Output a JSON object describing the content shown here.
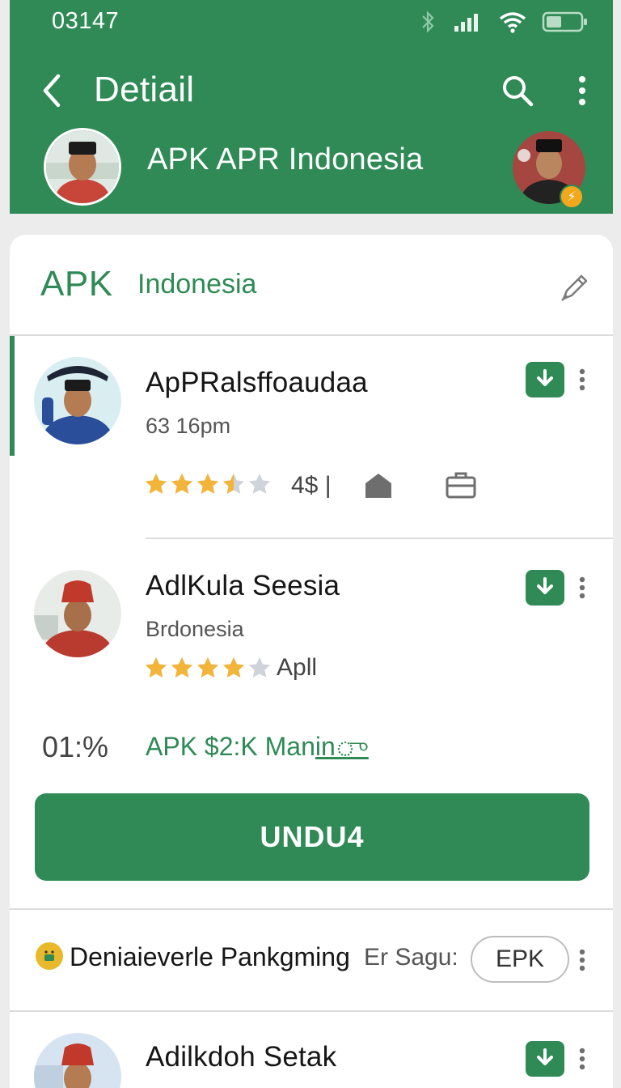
{
  "status_bar": {
    "time": "03147",
    "icons": [
      "bluetooth-icon",
      "signal-icon",
      "wifi-icon",
      "battery-icon"
    ]
  },
  "header": {
    "title": "Detiail",
    "profile_name": "APK APR Indonesia",
    "badge_symbol": "⚡"
  },
  "section": {
    "label": "APK",
    "country": "Indonesia"
  },
  "items": [
    {
      "title": "ApPRalsffoaudaa",
      "subtitle": "63 16pm",
      "rating": 3.5,
      "rating_text": "4$ |",
      "active": true
    },
    {
      "title": "AdlKula Seesia",
      "subtitle": "Brdonesia",
      "rating": 4,
      "rating_text": "Apll"
    },
    {
      "title": "Adilkdoh Setak"
    }
  ],
  "stats": {
    "percent": "01:%",
    "link_text": "APK $2:K Man",
    "link_suffix": "inு"
  },
  "primary_button": "UNDU4",
  "info_row": {
    "main": "Deniaieverle Pankgming",
    "side": "Er Sagu:",
    "chip": "EPK"
  },
  "colors": {
    "brand_green": "#2f8a56",
    "star_filled": "#f2b53a",
    "star_empty": "#cfd3da"
  }
}
